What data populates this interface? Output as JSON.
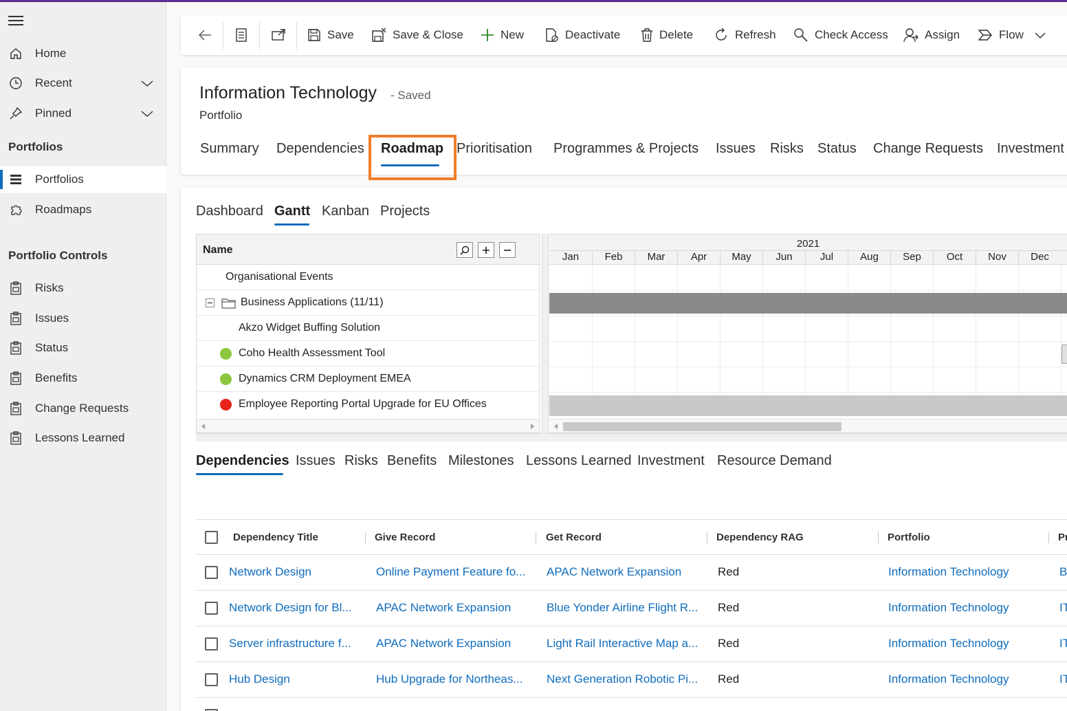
{
  "sidebar": {
    "home": "Home",
    "recent": "Recent",
    "pinned": "Pinned",
    "portfolios_section": "Portfolios",
    "portfolios": "Portfolios",
    "roadmaps": "Roadmaps",
    "controls_section": "Portfolio Controls",
    "controls": [
      "Risks",
      "Issues",
      "Status",
      "Benefits",
      "Change Requests",
      "Lessons Learned"
    ]
  },
  "toolbar": {
    "save": "Save",
    "save_close": "Save & Close",
    "new": "New",
    "deactivate": "Deactivate",
    "delete": "Delete",
    "refresh": "Refresh",
    "check_access": "Check Access",
    "assign": "Assign",
    "flow": "Flow"
  },
  "record": {
    "title": "Information Technology",
    "saved": "- Saved",
    "type": "Portfolio"
  },
  "tabs": [
    "Summary",
    "Dependencies",
    "Roadmap",
    "Prioritisation",
    "Programmes & Projects",
    "Issues",
    "Risks",
    "Status",
    "Change Requests",
    "Investment"
  ],
  "active_tab": "Roadmap",
  "subtabs": [
    "Dashboard",
    "Gantt",
    "Kanban",
    "Projects"
  ],
  "active_subtab": "Gantt",
  "gantt": {
    "name_header": "Name",
    "year": "2021",
    "months": [
      "Jan",
      "Feb",
      "Mar",
      "Apr",
      "May",
      "Jun",
      "Jul",
      "Aug",
      "Sep",
      "Oct",
      "Nov",
      "Dec"
    ],
    "rows": [
      {
        "name": "Organisational Events",
        "status": null
      },
      {
        "name": "Business Applications (11/11)",
        "status": null
      },
      {
        "name": "Akzo Widget Buffing Solution",
        "status": null
      },
      {
        "name": "Coho Health Assessment Tool",
        "status": "green"
      },
      {
        "name": "Dynamics CRM Deployment EMEA",
        "status": "green"
      },
      {
        "name": "Employee Reporting Portal Upgrade for EU Offices",
        "status": "red"
      }
    ],
    "colors": {
      "green": "#8cc63e",
      "red": "#e8231b",
      "summary_bar": "#8a8a8a",
      "task_bar": "#c8c8c8"
    }
  },
  "bottom_tabs": [
    "Dependencies",
    "Issues",
    "Risks",
    "Benefits",
    "Milestones",
    "Lessons Learned",
    "Investment",
    "Resource Demand"
  ],
  "active_bottom_tab": "Dependencies",
  "table": {
    "headers": [
      "Dependency Title",
      "Give Record",
      "Get Record",
      "Dependency RAG",
      "Portfolio",
      "Pr"
    ],
    "rows": [
      [
        "Network Design",
        "Online Payment Feature fo...",
        "APAC Network Expansion",
        "Red",
        "Information Technology",
        "B"
      ],
      [
        "Network Design for Bl...",
        "APAC Network Expansion",
        "Blue Yonder Airline Flight R...",
        "Red",
        "Information Technology",
        "IT"
      ],
      [
        "Server infrastructure f...",
        "APAC Network Expansion",
        "Light Rail Interactive Map a...",
        "Red",
        "Information Technology",
        "IT"
      ],
      [
        "Hub Design",
        "Hub Upgrade for Northeas...",
        "Next Generation Robotic Pi...",
        "Red",
        "Information Technology",
        "IT"
      ]
    ]
  },
  "accent": "#0f6cbd",
  "highlight": "#f07e29"
}
